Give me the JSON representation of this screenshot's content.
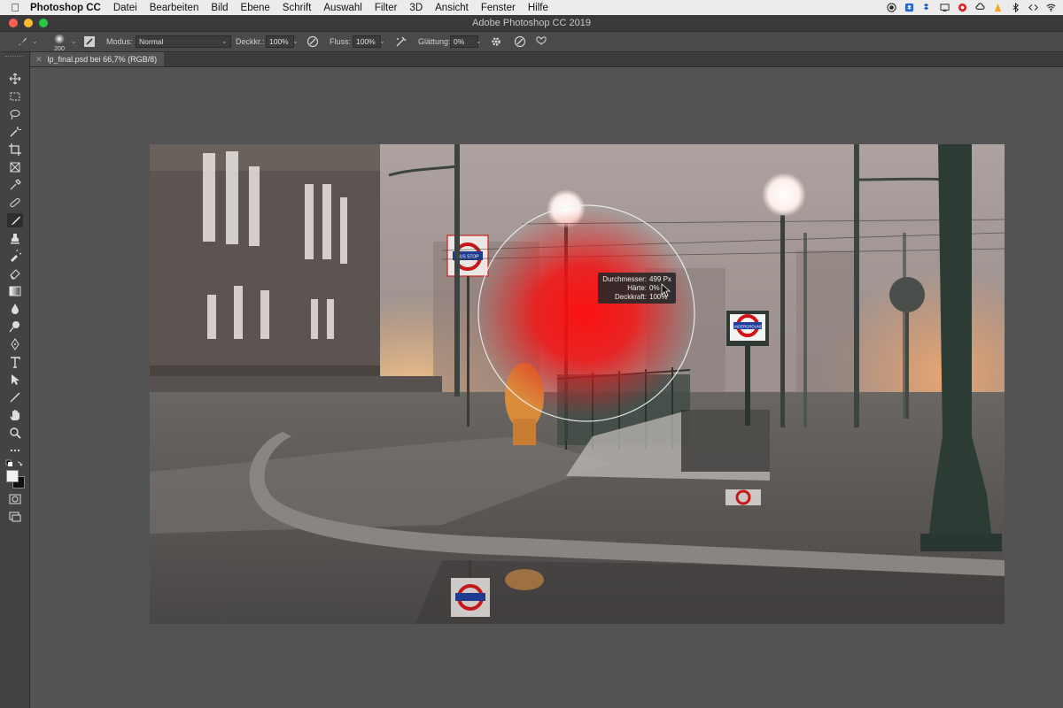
{
  "menubar": {
    "apple_icon": "apple-icon",
    "app_name": "Photoshop CC",
    "items": [
      "Datei",
      "Bearbeiten",
      "Bild",
      "Ebene",
      "Schrift",
      "Auswahl",
      "Filter",
      "3D",
      "Ansicht",
      "Fenster",
      "Hilfe"
    ],
    "status_icons": [
      "record-icon",
      "dropbox-icon",
      "screen-icon",
      "cloud-icon",
      "creative-cloud-icon",
      "vlc-icon",
      "bluetooth-icon",
      "code-icon",
      "wifi-icon"
    ]
  },
  "window": {
    "title": "Adobe Photoshop CC 2019"
  },
  "options": {
    "brush_size": "200",
    "modus_label": "Modus:",
    "modus_value": "Normal",
    "opacity_label": "Deckkr.:",
    "opacity_value": "100%",
    "flow_label": "Fluss:",
    "flow_value": "100%",
    "smoothing_label": "Glättung:",
    "smoothing_value": "0%"
  },
  "document": {
    "tab_label": "lp_final.psd bei 66,7% (RGB/8)"
  },
  "brush_tooltip": {
    "diameter_label": "Durchmesser:",
    "diameter_value": "499 Px",
    "hardness_label": "Härte:",
    "hardness_value": "0%",
    "opacity_label": "Deckkraft:",
    "opacity_value": "100%"
  },
  "scene": {
    "sign_text": "UNDERGROUND",
    "bus_stop_text": "BUS STOP"
  },
  "colors": {
    "brush_red": "#ff1a1a",
    "ui_dark": "#535353",
    "toolbar": "#434343"
  }
}
